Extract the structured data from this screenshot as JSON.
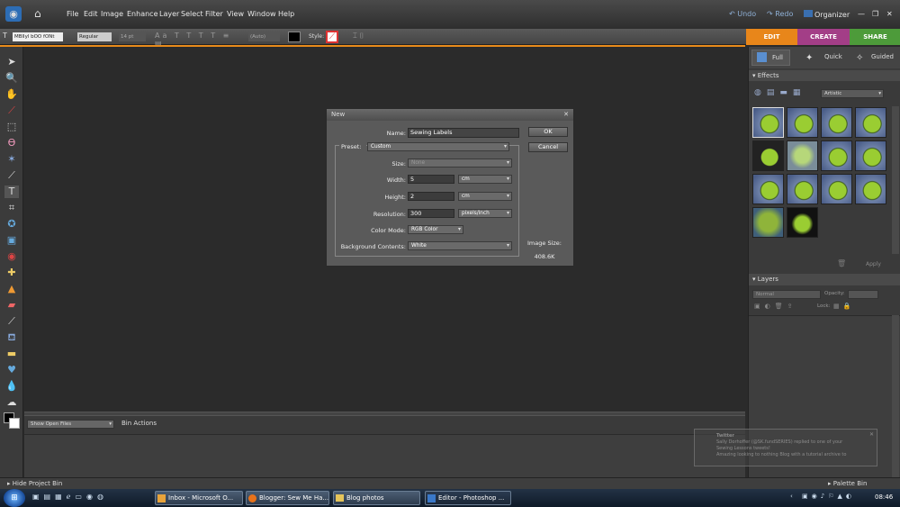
{
  "menu": [
    "File",
    "Edit",
    "Image",
    "Enhance",
    "Layer",
    "Select",
    "Filter",
    "View",
    "Window",
    "Help"
  ],
  "header": {
    "undo": "Undo",
    "redo": "Redo",
    "organizer": "Organizer"
  },
  "options": {
    "font": "MBllyl bOO fONt",
    "style": "Regular",
    "size": "14 pt",
    "leading": "(Auto)",
    "style_label": "Style:"
  },
  "tabs": {
    "edit": "EDIT",
    "create": "CREATE",
    "share": "SHARE",
    "full": "Full",
    "quick": "Quick",
    "guided": "Guided"
  },
  "effects": {
    "title": "Effects",
    "category": "Artistic",
    "apply": "Apply"
  },
  "layers": {
    "title": "Layers",
    "blend": "Normal",
    "opacity": "Opacity:",
    "lock": "Lock:"
  },
  "bin": {
    "show": "Show Open Files",
    "actions": "Bin Actions",
    "hide": "Hide Project Bin",
    "palette": "Palette Bin"
  },
  "dialog": {
    "title": "New",
    "name_label": "Name:",
    "name_value": "Sewing Labels",
    "ok": "OK",
    "cancel": "Cancel",
    "preset_label": "Preset:",
    "preset_value": "Custom",
    "size_label": "Size:",
    "size_value": "None",
    "width_label": "Width:",
    "width_value": "5",
    "width_unit": "cm",
    "height_label": "Height:",
    "height_value": "2",
    "height_unit": "cm",
    "res_label": "Resolution:",
    "res_value": "300",
    "res_unit": "pixels/inch",
    "mode_label": "Color Mode:",
    "mode_value": "RGB Color",
    "bg_label": "Background Contents:",
    "bg_value": "White",
    "imgsize_label": "Image Size:",
    "imgsize_value": "408.6K"
  },
  "notification": {
    "title": "Twitter",
    "line1": "Sally Dorhoffer (@SK.fundSERIES) replied to one of your",
    "line2": "Sewing Lessons tweets!",
    "line3": "Amazing looking to nothing Blog with a tutorial archive to"
  },
  "taskbar": {
    "items": [
      "Inbox - Microsoft O...",
      "Blogger: Sew Me Ha...",
      "Blog photos",
      "Editor - Photoshop ..."
    ],
    "time": "08:46"
  }
}
